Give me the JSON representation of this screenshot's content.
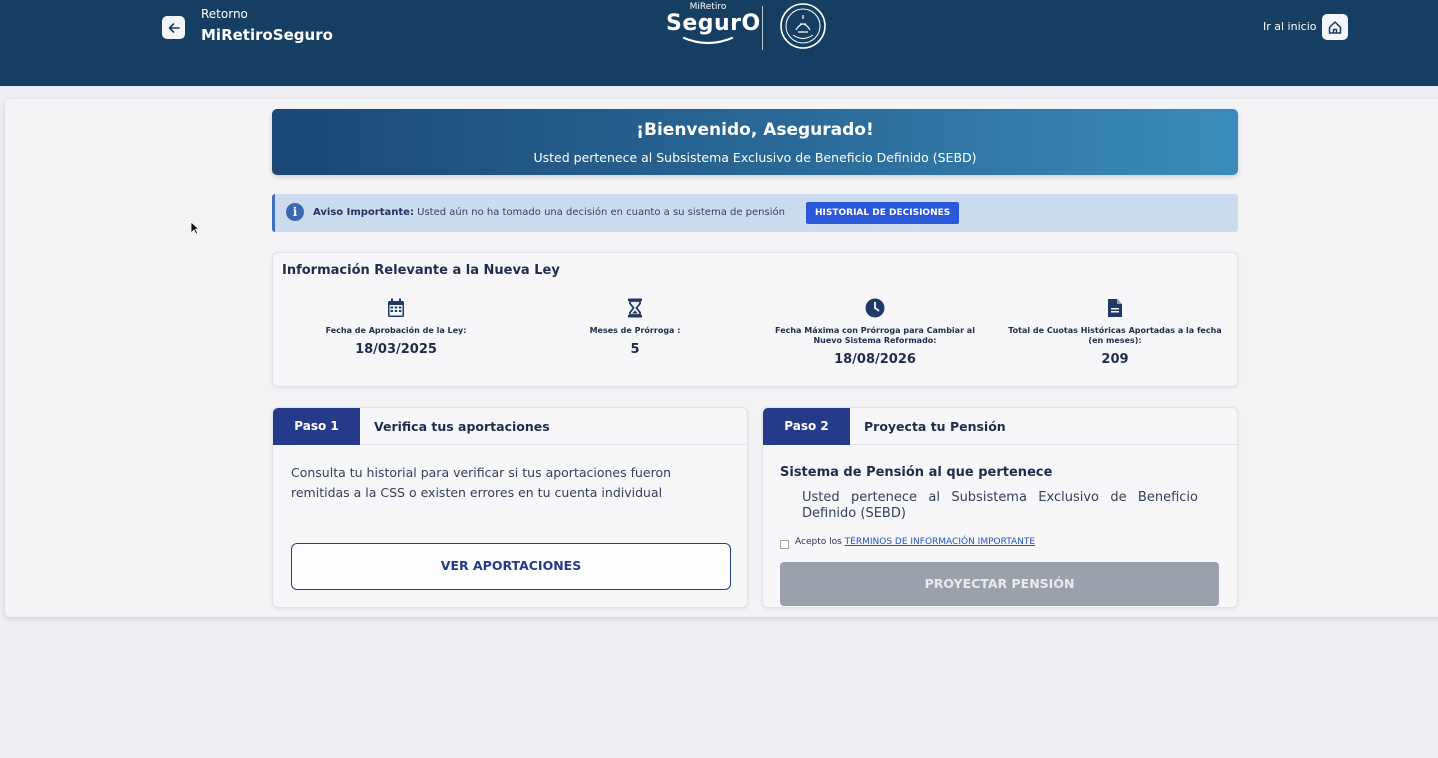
{
  "header": {
    "back_small": "Retorno",
    "back_big": "MiRetiroSeguro",
    "logo_top": "MiRetiro",
    "logo_main": "SegurO",
    "home_label": "Ir al inicio"
  },
  "welcome": {
    "title": "¡Bienvenido, Asegurado!",
    "subtitle": "Usted pertenece al Subsistema Exclusivo de Beneficio Definido (SEBD)"
  },
  "notice": {
    "bold": "Aviso Importante:",
    "text": " Usted aún no ha tomado una decisión en cuanto a su sistema de pensión",
    "button": "HISTORIAL DE DECISIONES"
  },
  "info": {
    "title": "Información Relevante a la Nueva Ley",
    "stats": [
      {
        "label": "Fecha de Aprobación de la Ley:",
        "value": "18/03/2025",
        "icon": "calendar-icon"
      },
      {
        "label": "Meses de Prórroga :",
        "value": "5",
        "icon": "hourglass-icon"
      },
      {
        "label": "Fecha Máxima con Prórroga para Cambiar al Nuevo Sistema Reformado:",
        "value": "18/08/2026",
        "icon": "clock-icon"
      },
      {
        "label": "Total de Cuotas Históricas Aportadas a la fecha (en meses):",
        "value": "209",
        "icon": "document-icon"
      }
    ]
  },
  "step1": {
    "badge": "Paso 1",
    "title": "Verifica tus aportaciones",
    "text": "Consulta tu historial para verificar si tus aportaciones fueron remitidas a la CSS o existen errores en tu cuenta individual",
    "button": "VER APORTACIONES"
  },
  "step2": {
    "badge": "Paso 2",
    "title": "Proyecta tu Pensión",
    "section_title": "Sistema de Pensión al que pertenece",
    "text": "Usted pertenece al Subsistema Exclusivo de Beneficio Definido (SEBD)",
    "terms_prefix": "Acepto los ",
    "terms_link": "TÉRMINOS DE INFORMACIÓN IMPORTANTE",
    "button": "PROYECTAR PENSIÓN"
  },
  "colors": {
    "header_bg": "#163e62",
    "step_badge": "#253b8a",
    "notice_btn": "#2b58d8",
    "disabled_btn": "#9ba1ab"
  }
}
